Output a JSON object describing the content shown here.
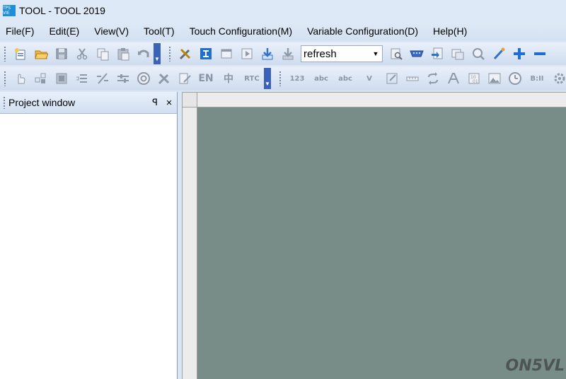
{
  "window": {
    "title": "TOOL - TOOL 2019",
    "logo_text": "TPS VIE"
  },
  "menu": [
    "File(F)",
    "Edit(E)",
    "View(V)",
    "Tool(T)",
    "Touch Configuration(M)",
    "Variable Configuration(D)",
    "Help(H)"
  ],
  "toolbar1": {
    "combo_value": "refresh",
    "icons": [
      "new-project-icon",
      "open-folder-icon",
      "save-icon",
      "cut-icon",
      "copy-icon",
      "paste-icon",
      "undo-icon",
      "tools-icon",
      "text-i-icon",
      "film-icon",
      "play-icon",
      "download-icon",
      "download-gray-icon",
      "preview-icon",
      "serial-port-icon",
      "export-icon",
      "window-icon",
      "search-icon",
      "pen-icon",
      "plus-icon",
      "minus-icon"
    ]
  },
  "toolbar2": {
    "text_buttons": {
      "en": "EN",
      "zh": "中",
      "rtc": "RTC",
      "num": "123",
      "abc1": "abc",
      "abc2": "abc",
      "v": "V",
      "bit": "B:II"
    }
  },
  "project_window": {
    "title": "Project window",
    "pin": "ꟼ",
    "close": "×"
  },
  "watermark": "ON5VL",
  "colors": {
    "canvas": "#788d87",
    "overflow": "#3a62b6",
    "accent_blue": "#1e8fd6"
  }
}
